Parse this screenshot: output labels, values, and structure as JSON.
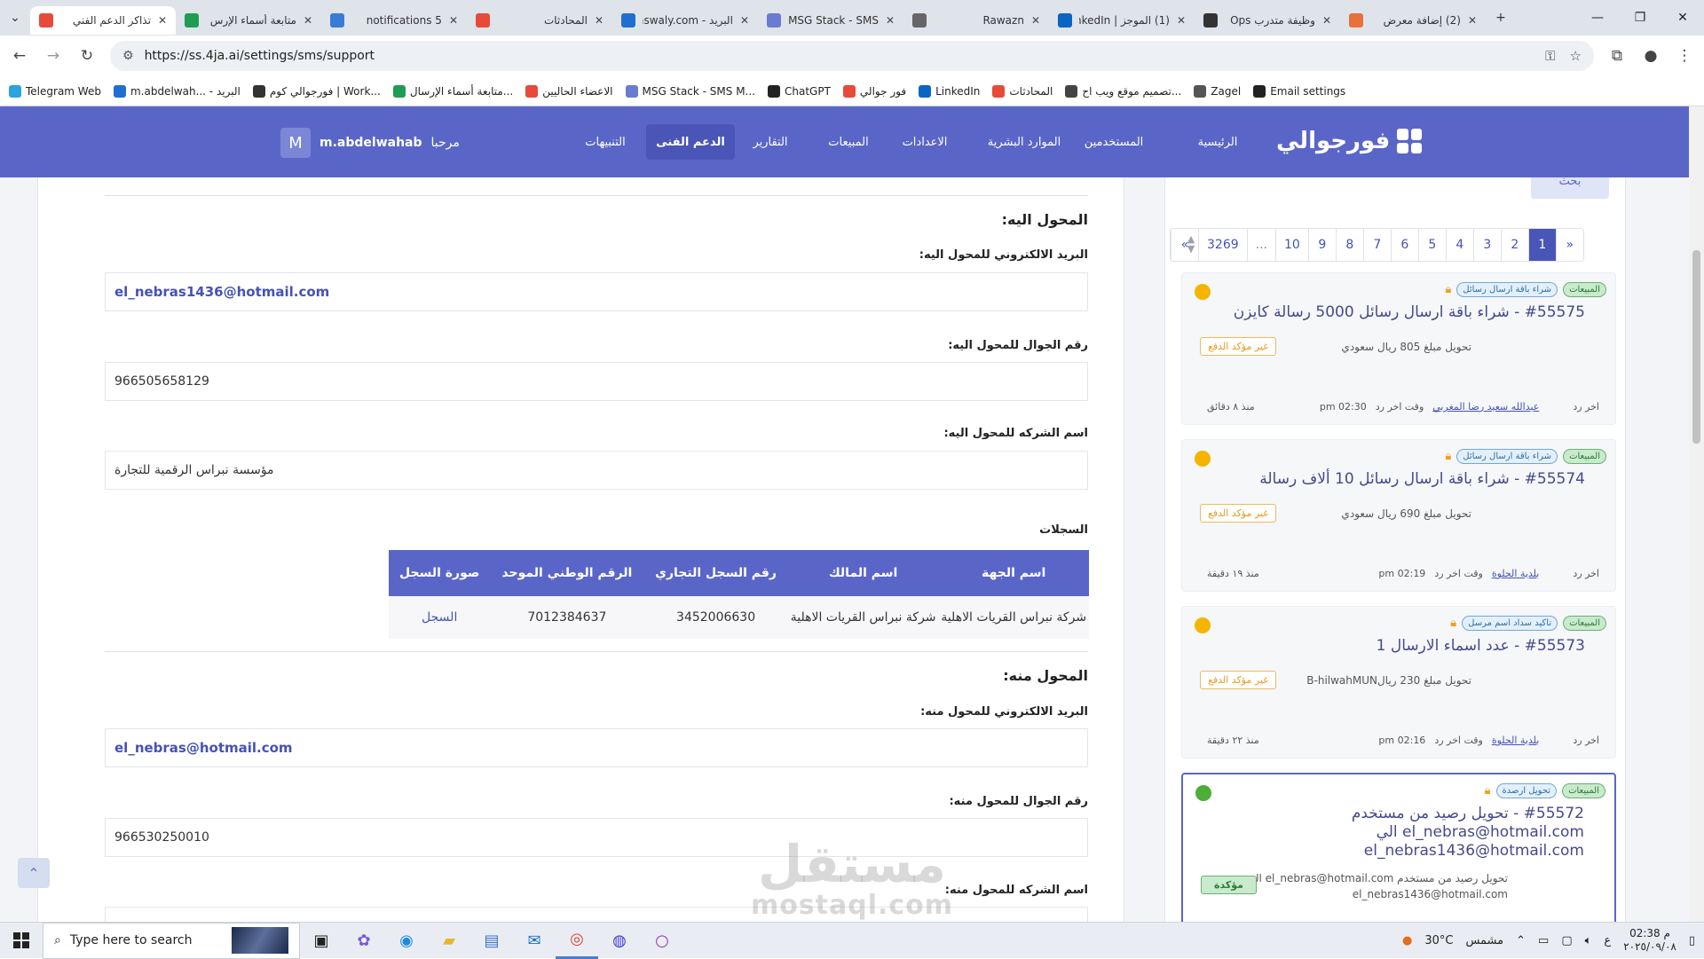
{
  "browser": {
    "tabs": [
      {
        "title": "تذاكر الدعم الفني",
        "color": "#e84a3a",
        "active": true
      },
      {
        "title": "متابعة أسماء الإرس",
        "color": "#1f9d55"
      },
      {
        "title": "5 notifications",
        "color": "#3a7bd5"
      },
      {
        "title": "المحادثات",
        "color": "#e84a3a"
      },
      {
        "title": "البريد - aswaly.com",
        "color": "#1f6fd1"
      },
      {
        "title": "MSG Stack - SMS",
        "color": "#6b7bd1"
      },
      {
        "title": "Rawazn",
        "color": "#666666"
      },
      {
        "title": "(1) الموجز | LinkedIn",
        "color": "#0a66c2"
      },
      {
        "title": "وظيفة متدرب Ops",
        "color": "#333333"
      },
      {
        "title": "(2) إضافة معرض",
        "color": "#e8703a"
      }
    ],
    "url": "https://ss.4ja.ai/settings/sms/support",
    "bookmarks": [
      {
        "label": "Telegram Web",
        "color": "#2aa3df"
      },
      {
        "label": "m.abdelwah... - البريد",
        "color": "#1f6fd1"
      },
      {
        "label": "فورجوالي كوم | Work...",
        "color": "#333333"
      },
      {
        "label": "متابعة أسماء الإرسال...",
        "color": "#1f9d55"
      },
      {
        "label": "الاعضاء الحاليين",
        "color": "#e84a3a"
      },
      {
        "label": "MSG Stack - SMS M...",
        "color": "#6b7bd1"
      },
      {
        "label": "ChatGPT",
        "color": "#222222"
      },
      {
        "label": "فور جوالي",
        "color": "#e84a3a"
      },
      {
        "label": "LinkedIn",
        "color": "#0a66c2"
      },
      {
        "label": "المحادثات",
        "color": "#e84a3a"
      },
      {
        "label": "تصميم موقع ويب اح...",
        "color": "#444444"
      },
      {
        "label": "Zagel",
        "color": "#555555"
      },
      {
        "label": "Email settings",
        "color": "#222222"
      }
    ]
  },
  "app": {
    "logo_text": "فورجوالي",
    "nav": [
      "الرئيسية",
      "المستخدمين",
      "الموارد البشرية",
      "الاعدادات",
      "المبيعات",
      "التقارير",
      "الدعم الفنى",
      "التنبيهات"
    ],
    "active_nav": "الدعم الفنى",
    "greeting": "مرحبا",
    "username": "m.abdelwahab",
    "avatar_letter": "M",
    "accent": "#5a66c7"
  },
  "detail": {
    "to_section": "المحول اليه:",
    "to_email_label": "البريد الالكتروني للمحول اليه:",
    "to_email": "el_nebras1436@hotmail.com",
    "to_phone_label": "رقم الجوال للمحول اليه:",
    "to_phone": "966505658129",
    "to_company_label": "اسم الشركه للمحول اليه:",
    "to_company": "مؤسسة نبراس الرقمية للتجارة",
    "records_label": "السجلات",
    "records_headers": [
      "اسم الجهة",
      "اسم المالك",
      "رقم السجل التجاري",
      "الرقم الوطني الموحد",
      "صورة السجل"
    ],
    "records_row": [
      "شركة نبراس القريات الاهلية",
      "شركة نبراس القريات الاهلية",
      "3452006630",
      "7012384637",
      "السجل"
    ],
    "from_section": "المحول منه:",
    "from_email_label": "البريد الالكتروني للمحول منه:",
    "from_email": "el_nebras@hotmail.com",
    "from_phone_label": "رقم الجوال للمحول منه:",
    "from_phone": "966530250010",
    "from_company_label": "اسم الشركه للمحول منه:"
  },
  "sidebar": {
    "search_button": "بحث",
    "pages": [
      "«",
      "1",
      "2",
      "3",
      "4",
      "5",
      "6",
      "7",
      "8",
      "9",
      "10",
      "...",
      "3269",
      "»"
    ],
    "current_page": "1",
    "tickets": [
      {
        "category": "المبيعات",
        "type": "شراء باقة ارسال رسائل",
        "title": "#55575 - شراء باقة ارسال رسائل 5000 رسالة كايزن",
        "amount": "تحويل مبلغ 805 ريال سعودي",
        "state": "غير مؤكد الدفع",
        "last_reply_label": "اخر رد",
        "last_reply_by": "عبدالله سعيد رضا المغربي",
        "time_label": "وقت اخر رد",
        "time": "02:30 pm",
        "ago": "منذ ٨ دقائق",
        "dot": "#f4b400"
      },
      {
        "category": "المبيعات",
        "type": "شراء باقة ارسال رسائل",
        "title": "#55574 - شراء باقة ارسال رسائل 10 ألاف رسالة",
        "amount": "تحويل مبلغ 690 ريال سعودي",
        "state": "غير مؤكد الدفع",
        "last_reply_label": "اخر رد",
        "last_reply_by": "بلدية الحلوة",
        "time_label": "وقت اخر رد",
        "time": "02:19 pm",
        "ago": "منذ ١٩ دقيقة",
        "dot": "#f4b400"
      },
      {
        "category": "المبيعات",
        "type": "تاكيد سداد اسم مرسل",
        "title": "#55573 - عدد اسماء الارسال 1",
        "amount": "تحويل مبلغ 230 ريالB-hilwahMUN",
        "state": "غير مؤكد الدفع",
        "last_reply_label": "اخر رد",
        "last_reply_by": "بلدية الحلوة",
        "time_label": "وقت اخر رد",
        "time": "02:16 pm",
        "ago": "منذ ٢٢ دقيقة",
        "dot": "#f4b400"
      },
      {
        "category": "المبيعات",
        "type": "تحويل ارصدة",
        "title_l1": "#55572 - تحويل رصيد من مستخدم",
        "title_l2": "el_nebras@hotmail.com الي",
        "title_l3": "el_nebras1436@hotmail.com",
        "amount_l1": "تحويل رصيد من مستخدم el_nebras@hotmail.com الي",
        "amount_l2": "el_nebras1436@hotmail.com",
        "state": "مؤكدة",
        "dot": "#4caf35"
      }
    ]
  },
  "watermark": {
    "line1": "مستقل",
    "line2": "mostaql.com"
  },
  "taskbar": {
    "search_placeholder": "Type here to search",
    "weather": "30°C",
    "weather_label": "مشمس",
    "time": "02:38 م",
    "date": "٢٠٢٥/٠٩/٠٨",
    "lang": "ع"
  }
}
